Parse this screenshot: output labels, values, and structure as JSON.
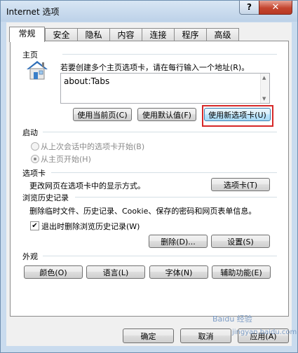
{
  "window": {
    "title": "Internet 选项",
    "help": "?",
    "close": "✕"
  },
  "tabs": [
    "常规",
    "安全",
    "隐私",
    "内容",
    "连接",
    "程序",
    "高级"
  ],
  "home": {
    "section": "主页",
    "description": "若要创建多个主页选项卡，请在每行输入一个地址(R)。",
    "url": "about:Tabs",
    "buttons": [
      "使用当前页(C)",
      "使用默认值(F)",
      "使用新选项卡(U)"
    ]
  },
  "startup": {
    "section": "启动",
    "options": [
      "从上次会话中的选项卡开始(B)",
      "从主页开始(H)"
    ]
  },
  "tabs_section": {
    "section": "选项卡",
    "description": "更改网页在选项卡中的显示方式。",
    "button": "选项卡(T)"
  },
  "history": {
    "section": "浏览历史记录",
    "description": "删除临时文件、历史记录、Cookie、保存的密码和网页表单信息。",
    "checkbox_label": "退出时删除浏览历史记录(W)",
    "delete_button": "删除(D)...",
    "settings_button": "设置(S)"
  },
  "appearance": {
    "section": "外观",
    "buttons": [
      "颜色(O)",
      "语言(L)",
      "字体(N)",
      "辅助功能(E)"
    ]
  },
  "footer": {
    "ok": "确定",
    "cancel": "取消",
    "apply": "应用(A)"
  },
  "watermark": {
    "main": "Baidu 经验",
    "sub": "jingyan.baidu.com"
  },
  "colors": {
    "highlight": "#d62828",
    "title_bar": "#c9dbee"
  },
  "icons": {
    "home": "house-icon"
  }
}
